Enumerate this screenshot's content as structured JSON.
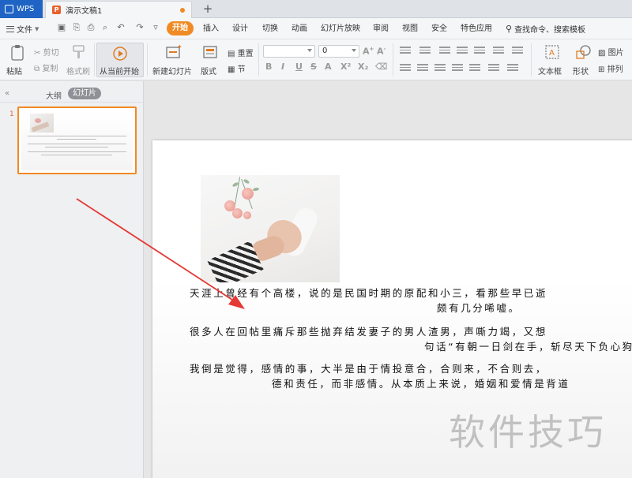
{
  "tabs": {
    "app": "WPS",
    "document": "演示文稿1",
    "new_tab": "+"
  },
  "menu": {
    "file": "文件",
    "items": [
      "开始",
      "插入",
      "设计",
      "切换",
      "动画",
      "幻灯片放映",
      "审阅",
      "视图",
      "安全",
      "特色应用"
    ],
    "search": "查找命令、搜索模板"
  },
  "ribbon": {
    "paste": "粘贴",
    "cut": "剪切",
    "copy": "复制",
    "format_painter": "格式刷",
    "from_current": "从当前开始",
    "new_slide": "新建幻灯片",
    "layout": "版式",
    "reset": "重置",
    "section": "节",
    "font_size": "0",
    "bold": "B",
    "italic": "I",
    "underline": "U",
    "strike": "S",
    "text_box": "文本框",
    "shape": "形状",
    "picture": "图片",
    "arrange": "排列"
  },
  "left_panel": {
    "outline": "大纲",
    "slides": "幻灯片",
    "slide_number": "1"
  },
  "slide": {
    "p1_line1": "天涯上曾经有个高楼，说的是民国时期的原配和小三，看那些早已逝",
    "p1_line2": "颇有几分唏嘘。",
    "p2_line1": "很多人在回帖里痛斥那些抛弃结发妻子的男人渣男，声嘶力竭，又想",
    "p2_line2": "句话“有朝一日剑在手，斩尽天下负心狗。”不由得",
    "p3_line1": "我倒是觉得，感情的事，大半是由于情投意合，合则来，不合则去，",
    "p3_line2": "德和责任，而非感情。从本质上来说，婚姻和爱情是背道"
  },
  "watermark": "软件技巧",
  "colors": {
    "accent": "#f08a24",
    "wps_blue": "#1f64c4",
    "arrow": "#e53935"
  }
}
